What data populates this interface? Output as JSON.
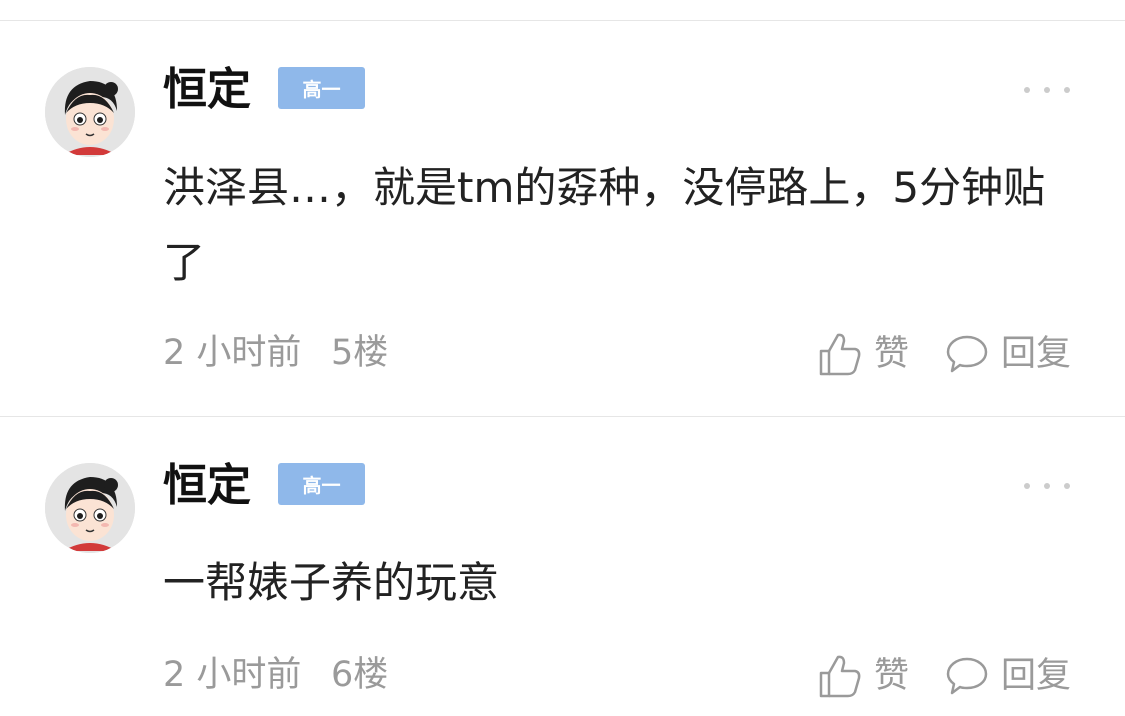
{
  "comments": [
    {
      "username": "恒定",
      "grade_badge": "高一",
      "content": "洪泽县…，就是tm的孬种，没停路上，5分钟贴了",
      "time": "2 小时前",
      "floor": "5楼",
      "like_label": "赞",
      "reply_label": "回复"
    },
    {
      "username": "恒定",
      "grade_badge": "高一",
      "content": "一帮婊子养的玩意",
      "time": "2 小时前",
      "floor": "6楼",
      "like_label": "赞",
      "reply_label": "回复"
    }
  ],
  "icons": {
    "avatar": "cartoon-girl-avatar",
    "more": "more-dots-icon",
    "like": "thumbs-up-icon",
    "reply": "speech-bubble-icon"
  },
  "colors": {
    "badge": "#8fb8ea",
    "text_primary": "#222222",
    "text_meta": "#9a9a9a",
    "divider": "#e6e6e6"
  }
}
